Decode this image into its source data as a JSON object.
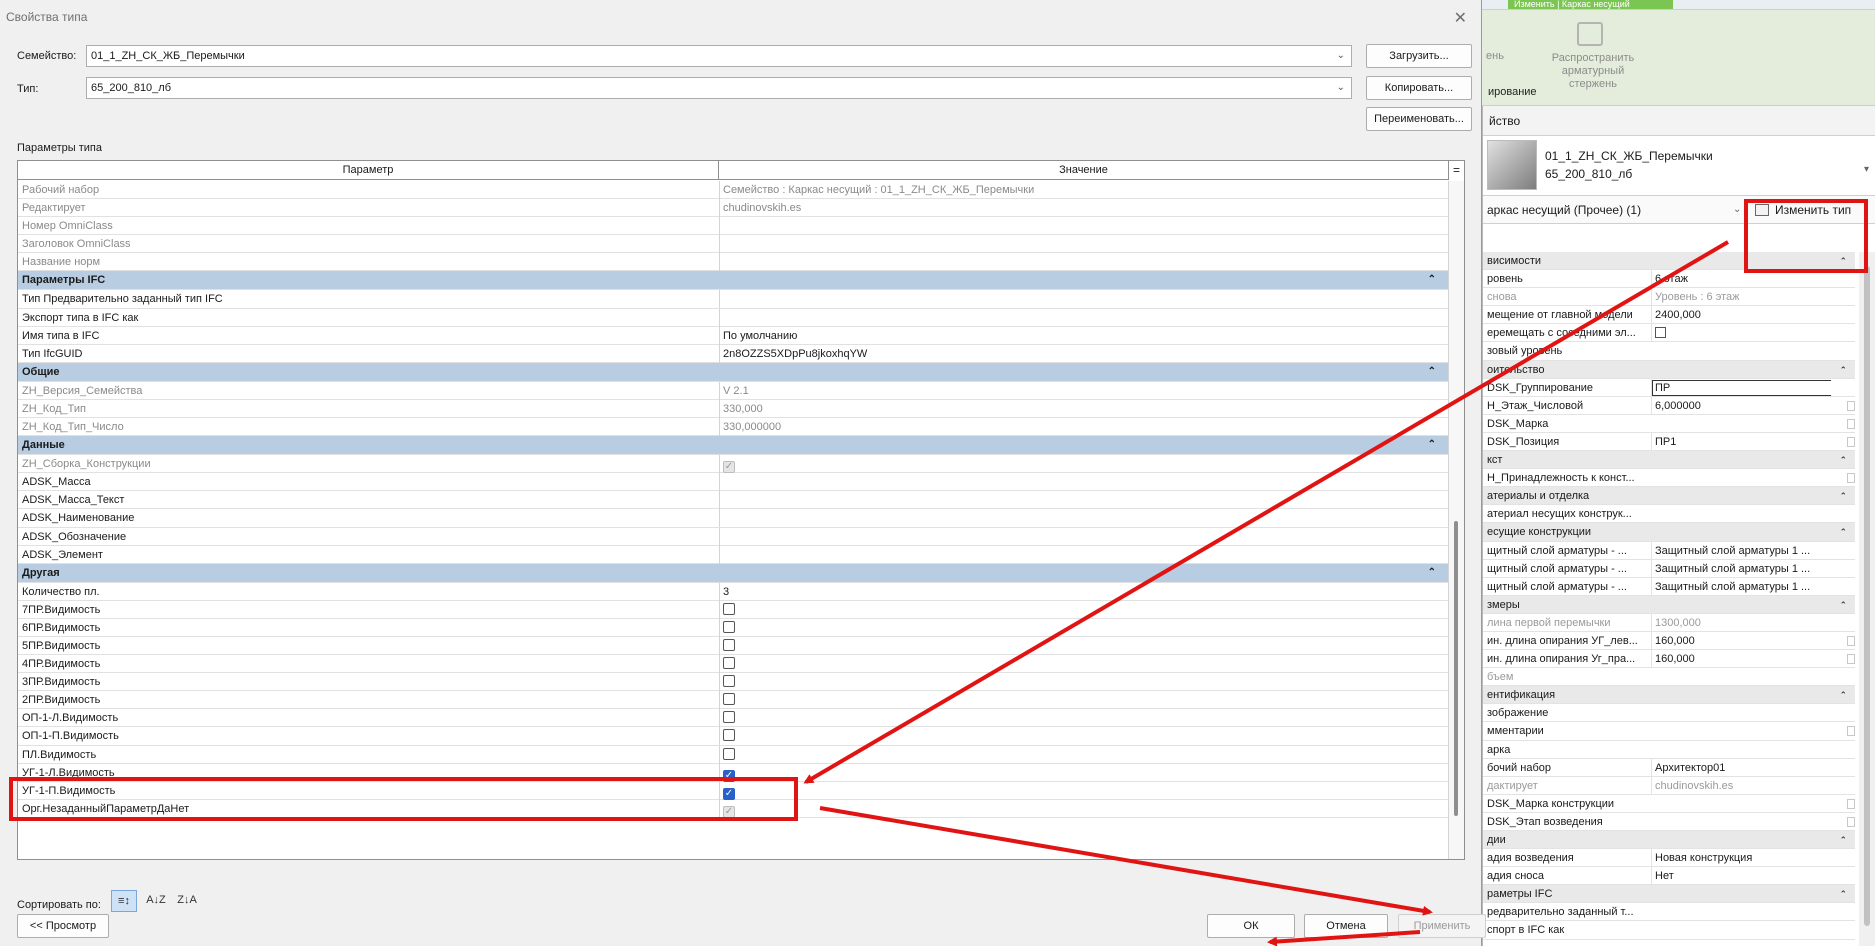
{
  "ribbon": {
    "context_tab": "Изменить | Каркас несущий",
    "tool_label_partial": "ень",
    "tool_label": "Распространить арматурный стержень",
    "group_label": "ирование"
  },
  "props_panel": {
    "header": "йство",
    "type_name_line1": "01_1_ZH_СК_ЖБ_Перемычки",
    "type_name_line2": "65_200_810_лб",
    "category_selector": "аркас несущий (Прочее) (1)",
    "edit_type_label": "Изменить тип",
    "rows": [
      {
        "k": "висимости",
        "group": true
      },
      {
        "k": "ровень",
        "v": "6 этаж"
      },
      {
        "k": "снова",
        "v": "Уровень : 6 этаж",
        "dim": true
      },
      {
        "k": "мещение от главной модели",
        "v": "2400,000"
      },
      {
        "k": "еремещать с соседними эл...",
        "v": "",
        "checkbox": true
      },
      {
        "k": "зовый уровень",
        "v": ""
      },
      {
        "k": "оительство",
        "group": true
      },
      {
        "k": "DSK_Группирование",
        "v": "ПР",
        "input": true
      },
      {
        "k": "Н_Этаж_Числовой",
        "v": "6,000000",
        "mini": true
      },
      {
        "k": "DSK_Марка",
        "v": "",
        "mini": true
      },
      {
        "k": "DSK_Позиция",
        "v": "ПР1",
        "mini": true
      },
      {
        "k": "кст",
        "group": true
      },
      {
        "k": "Н_Принадлежность к конст...",
        "v": "",
        "mini": true
      },
      {
        "k": "атериалы и отделка",
        "group": true
      },
      {
        "k": "атериал несущих конструк...",
        "v": ""
      },
      {
        "k": "есущие конструкции",
        "group": true
      },
      {
        "k": "щитный слой арматуры - ...",
        "v": "Защитный слой арматуры 1 ..."
      },
      {
        "k": "щитный слой арматуры - ...",
        "v": "Защитный слой арматуры 1 ..."
      },
      {
        "k": "щитный слой арматуры - ...",
        "v": "Защитный слой арматуры 1 ..."
      },
      {
        "k": "змеры",
        "group": true
      },
      {
        "k": "лина первой перемычки",
        "v": "1300,000",
        "dim": true
      },
      {
        "k": "ин. длина опирания УГ_лев...",
        "v": "160,000",
        "mini": true
      },
      {
        "k": "ин. длина опирания Уг_пра...",
        "v": "160,000",
        "mini": true
      },
      {
        "k": "бъем",
        "v": "",
        "dim": true
      },
      {
        "k": "ентификация",
        "group": true
      },
      {
        "k": "зображение",
        "v": ""
      },
      {
        "k": "мментарии",
        "v": "",
        "mini": true
      },
      {
        "k": "арка",
        "v": ""
      },
      {
        "k": "бочий набор",
        "v": "Архитектор01"
      },
      {
        "k": "дактирует",
        "v": "chudinovskih.es",
        "dim": true
      },
      {
        "k": "DSK_Марка конструкции",
        "v": "",
        "mini": true
      },
      {
        "k": "DSK_Этап возведения",
        "v": "",
        "mini": true
      },
      {
        "k": "дии",
        "group": true
      },
      {
        "k": "адия возведения",
        "v": "Новая конструкция"
      },
      {
        "k": "адия сноса",
        "v": "Нет"
      },
      {
        "k": "раметры IFC",
        "group": true
      },
      {
        "k": "редварительно заданный т...",
        "v": ""
      },
      {
        "k": "спорт в IFC как",
        "v": ""
      }
    ]
  },
  "dialog": {
    "title": "Свойства типа",
    "family_label": "Семейство:",
    "family_value": "01_1_ZH_СК_ЖБ_Перемычки",
    "type_label": "Тип:",
    "type_value": "65_200_810_лб",
    "load_button": "Загрузить...",
    "copy_button": "Копировать...",
    "rename_button": "Переименовать...",
    "params_title": "Параметры типа",
    "col_param": "Параметр",
    "col_value": "Значение",
    "col_eq": "=",
    "rows": [
      {
        "k": "Рабочий набор",
        "v": "Семейство  : Каркас несущий : 01_1_ZH_СК_ЖБ_Перемычки",
        "dim": true
      },
      {
        "k": "Редактирует",
        "v": "chudinovskih.es",
        "dim": true
      },
      {
        "k": "Номер OmniClass",
        "v": "",
        "dim": true
      },
      {
        "k": "Заголовок OmniClass",
        "v": "",
        "dim": true
      },
      {
        "k": "Название норм",
        "v": "",
        "dim": true
      },
      {
        "k": "Параметры IFC",
        "group": true
      },
      {
        "k": "Тип Предварительно заданный тип IFC",
        "v": "",
        "mini": true
      },
      {
        "k": "Экспорт типа в IFC как",
        "v": "",
        "mini": true
      },
      {
        "k": "Имя типа в IFC",
        "v": "По умолчанию",
        "mini": true
      },
      {
        "k": "Тип IfcGUID",
        "v": "2n8OZZS5XDpPu8jkoxhqYW",
        "mini": true
      },
      {
        "k": "Общие",
        "group": true
      },
      {
        "k": "ZH_Версия_Семейства",
        "v": "V 2.1",
        "dim": true
      },
      {
        "k": "ZH_Код_Тип",
        "v": "330,000",
        "dim": true
      },
      {
        "k": "ZH_Код_Тип_Число",
        "v": "330,000000",
        "dim": true
      },
      {
        "k": "Данные",
        "group": true
      },
      {
        "k": "ZH_Сборка_Конструкции",
        "v": "",
        "cb": "gray",
        "dim": true
      },
      {
        "k": "ADSK_Масса",
        "v": "",
        "mini": true
      },
      {
        "k": "ADSK_Масса_Текст",
        "v": "",
        "mini": true
      },
      {
        "k": "ADSK_Наименование",
        "v": "",
        "mini": true
      },
      {
        "k": "ADSK_Обозначение",
        "v": "",
        "mini": true
      },
      {
        "k": "ADSK_Элемент",
        "v": "",
        "mini": true
      },
      {
        "k": "Другая",
        "group": true
      },
      {
        "k": "Количество пл.",
        "v": "3",
        "mini": true
      },
      {
        "k": "7ПР.Видимость",
        "v": "",
        "cb": "off",
        "mini": true
      },
      {
        "k": "6ПР.Видимость",
        "v": "",
        "cb": "off",
        "mini": true
      },
      {
        "k": "5ПР.Видимость",
        "v": "",
        "cb": "off",
        "mini": true
      },
      {
        "k": "4ПР.Видимость",
        "v": "",
        "cb": "off",
        "mini": true
      },
      {
        "k": "3ПР.Видимость",
        "v": "",
        "cb": "off",
        "mini": true
      },
      {
        "k": "2ПР.Видимость",
        "v": "",
        "cb": "off",
        "mini": true
      },
      {
        "k": "ОП-1-Л.Видимость",
        "v": "",
        "cb": "off",
        "mini": true
      },
      {
        "k": "ОП-1-П.Видимость",
        "v": "",
        "cb": "off",
        "mini": true
      },
      {
        "k": "ПЛ.Видимость",
        "v": "",
        "cb": "off",
        "mini": true
      },
      {
        "k": "УГ-1-Л.Видимость",
        "v": "",
        "cb": "on",
        "mini": true
      },
      {
        "k": "УГ-1-П.Видимость",
        "v": "",
        "cb": "on",
        "mini": true
      },
      {
        "k": "Орг.НезаданныйПараметрДаНет",
        "v": "",
        "cb": "gray",
        "mini": true
      }
    ],
    "sort_label": "Сортировать по:",
    "sort_icons": [
      "sort-grouped-icon",
      "sort-az-icon",
      "sort-za-icon"
    ],
    "preview_button": "<< Просмотр",
    "ok_button": "ОК",
    "cancel_button": "Отмена",
    "apply_button": "Применить"
  },
  "annotations": {
    "color": "#e11414"
  }
}
